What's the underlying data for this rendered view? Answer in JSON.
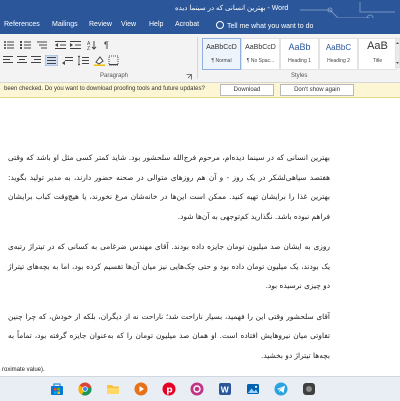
{
  "window": {
    "title": "بهترین انسانی که در سینما دیده - Word"
  },
  "menu": {
    "items": [
      "References",
      "Mailings",
      "Review",
      "View",
      "Help",
      "Acrobat"
    ],
    "tell_me": "Tell me what you want to do"
  },
  "ribbon": {
    "paragraph_label": "Paragraph",
    "styles_label": "Styles",
    "styles": [
      {
        "sample": "AaBbCcD",
        "name": "¶ Normal",
        "selected": true
      },
      {
        "sample": "AaBbCcD",
        "name": "¶ No Spac..."
      },
      {
        "sample": "AaBb",
        "name": "Heading 1"
      },
      {
        "sample": "AaBbC",
        "name": "Heading 2"
      },
      {
        "sample": "AaB",
        "name": "Title"
      }
    ]
  },
  "notice": {
    "message": "been checked. Do you want to download proofing tools and future updates?",
    "download": "Download",
    "dismiss": "Don't show again"
  },
  "document": {
    "paragraphs": [
      "بهترین انسانی که در سینما دیده‌ام، مرحوم فرج‌الله سلحشور بود. شاید کمتر کسی مثل او باشد که وقتی هفتصد سیاهی‌لشکر در یک روز - و آن هم روزهای متوالی در صحنه حضور دارند، به مدیر تولید بگوید: بهترین غذا را برایشان تهیه کنید. ممکن است این‌ها در خانه‌شان مرغ نخورند، یا هیچ‌وقت کباب برایشان فراهم نبوده باشد. نگذارید کم‌توجهی به آن‌ها شود.",
      "روزی به ایشان صد میلیون تومان جایزه داده بودند. آقای مهندس ضرغامی به کسانی که در تیتراژ رتبه‌ی یک بودند، یک میلیون تومان داده بود و حتی چک‌هایی نیز میان آن‌ها تقسیم کرده بود، اما به بچه‌های تیتراژ دو چیزی نرسیده بود.",
      "آقای سلحشور وقتی این را فهمید، بسیار ناراحت شد؛ ناراحت نه از دیگران، بلکه از خودش، که چرا چنین تفاوتی میان نیروهایش افتاده است. او همان صد میلیون تومان را که به‌عنوان جایزه گرفته بود، تماماً به بچه‌ها تیتراژ دو بخشید."
    ]
  },
  "status": {
    "text": "roximate value)."
  },
  "taskbar": {
    "icons": [
      "store-icon",
      "chrome-icon",
      "file-explorer-icon",
      "media-icon",
      "pinterest-icon",
      "image-viewer-icon",
      "word-icon",
      "photos-icon",
      "telegram-icon",
      "app-icon"
    ]
  }
}
